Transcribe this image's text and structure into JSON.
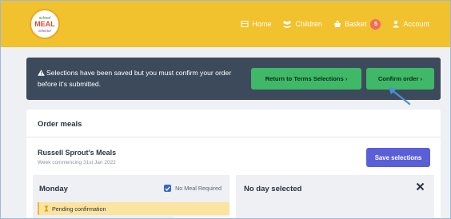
{
  "header": {
    "nav": [
      {
        "label": "Home",
        "icon": "home-icon"
      },
      {
        "label": "Children",
        "icon": "children-icon"
      },
      {
        "label": "Basket",
        "icon": "basket-icon",
        "badge": "5"
      },
      {
        "label": "Account",
        "icon": "account-icon"
      }
    ],
    "logo": {
      "text": [
        "school",
        "MEAL",
        "selector"
      ]
    },
    "colors": {
      "bar": "#f2c12e",
      "badge": "#f26b5b"
    }
  },
  "alert": {
    "message": "Selections have been saved but you must confirm your order before it's submitted.",
    "icon": "warning-icon",
    "return_label": "Return to Terms Selections ›",
    "confirm_label": "Confirm order ›",
    "colors": {
      "background": "#3d4a5c",
      "button": "#3fb968"
    }
  },
  "card": {
    "title": "Order meals",
    "meals_title": "Russell Sprout's Meals",
    "week": "Week commencing 31st Jan 2022",
    "save_label": "Save selections",
    "colors": {
      "save": "#5a5fd8"
    }
  },
  "day": {
    "name": "Monday",
    "no_meal_label": "No Meal Required",
    "no_meal_checked": true,
    "pending": "Pending confirmation",
    "pending_icon": "hourglass-icon"
  },
  "detail": {
    "title": "No day selected",
    "close_icon": "close-icon"
  }
}
